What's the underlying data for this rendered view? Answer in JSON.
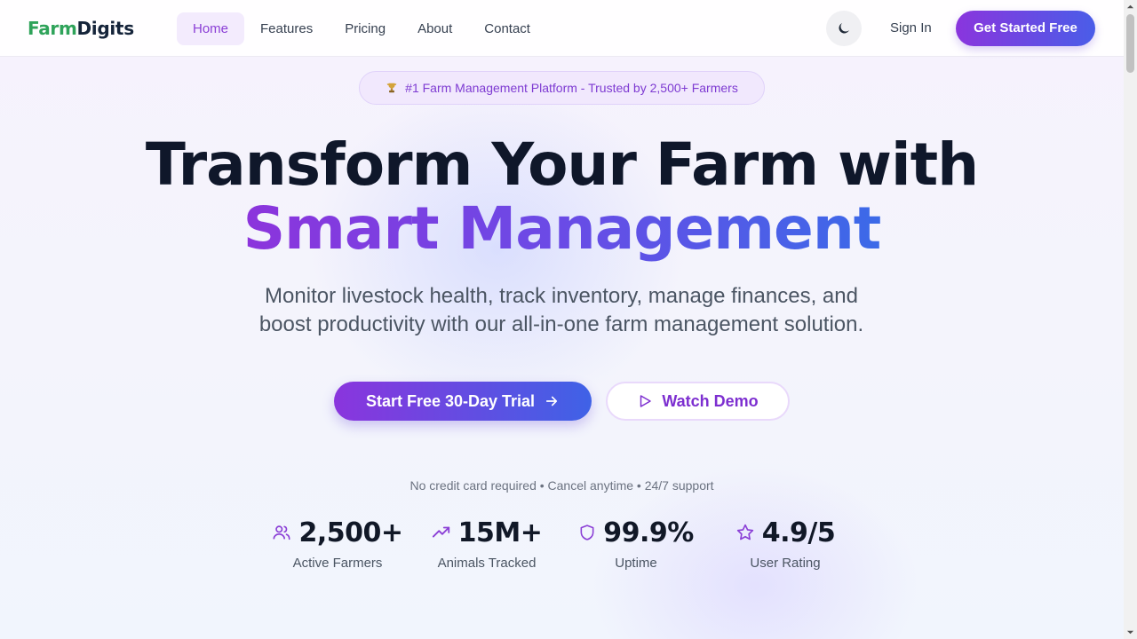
{
  "brand": {
    "logo_part1": "Farm",
    "logo_part2": "Digits"
  },
  "nav": {
    "items": [
      {
        "label": "Home",
        "active": true
      },
      {
        "label": "Features"
      },
      {
        "label": "Pricing"
      },
      {
        "label": "About"
      },
      {
        "label": "Contact"
      }
    ]
  },
  "header": {
    "theme_icon": "moon-icon",
    "signin_label": "Sign In",
    "cta_label": "Get Started Free"
  },
  "hero": {
    "badge": "#1 Farm Management Platform - Trusted by 2,500+ Farmers",
    "badge_icon": "trophy-icon",
    "title_line1": "Transform Your Farm with",
    "title_line2": "Smart Management",
    "subtitle_line1": "Monitor livestock health, track inventory, manage finances, and",
    "subtitle_line2": "boost productivity with our all-in-one farm management solution.",
    "trial_label": "Start Free 30-Day Trial",
    "demo_label": "Watch Demo",
    "note": "No credit card required • Cancel anytime • 24/7 support"
  },
  "stats": [
    {
      "icon": "users-icon",
      "value": "2,500+",
      "label": "Active Farmers"
    },
    {
      "icon": "trending-up-icon",
      "value": "15M+",
      "label": "Animals Tracked"
    },
    {
      "icon": "shield-icon",
      "value": "99.9%",
      "label": "Uptime"
    },
    {
      "icon": "star-icon",
      "value": "4.9/5",
      "label": "User Rating"
    }
  ],
  "colors": {
    "accent_purple": "#8a35dd",
    "accent_blue": "#3f62e6",
    "brand_green": "#2fa35a"
  }
}
